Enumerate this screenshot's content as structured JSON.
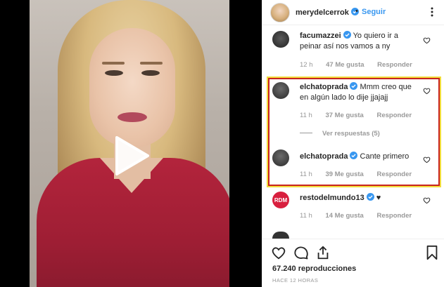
{
  "header": {
    "username": "merydelcerrok",
    "separator": "•",
    "follow_label": "Seguir"
  },
  "comments": [
    {
      "username": "facumazzei",
      "text": "Yo quiero ir a peinar así nos vamos a ny",
      "time": "12 h",
      "likes": "47 Me gusta",
      "reply": "Responder"
    },
    {
      "username": "elchatoprada",
      "text": "Mmm creo que en algún lado lo dije jjajajj",
      "time": "11 h",
      "likes": "37 Me gusta",
      "reply": "Responder"
    },
    {
      "username": "elchatoprada",
      "text": "Cante primero",
      "time": "11 h",
      "likes": "39 Me gusta",
      "reply": "Responder"
    },
    {
      "username": "restodelmundo13",
      "text": "♥",
      "time": "11 h",
      "likes": "14 Me gusta",
      "reply": "Responder",
      "avatar_label": "RDM"
    }
  ],
  "view_replies": "Ver respuestas (5)",
  "stats": {
    "views": "67.240 reproducciones",
    "time_ago": "HACE 12 HORAS"
  },
  "icons": {
    "play": "play-icon",
    "heart": "heart-outline-icon",
    "comment": "comment-icon",
    "share": "share-icon",
    "save": "bookmark-icon",
    "more": "more-options-icon",
    "verified": "verified-badge-icon"
  },
  "colors": {
    "accent": "#3897f0",
    "highlight_border": "#c8231e",
    "highlight_glow": "#f2dc3a",
    "verified": "#3897f0"
  }
}
